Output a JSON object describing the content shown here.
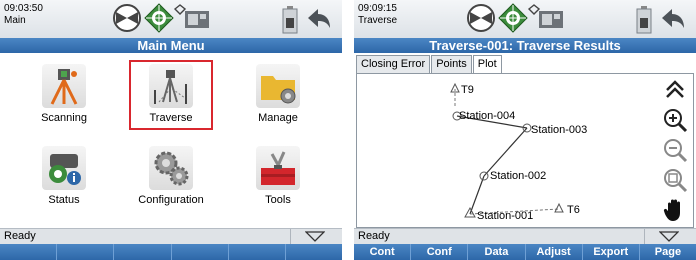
{
  "left_panel": {
    "clock": {
      "time": "09:03:50",
      "mode": "Main"
    },
    "title": "Main Menu",
    "items": [
      {
        "label": "Scanning",
        "icon": "scanning-icon"
      },
      {
        "label": "Traverse",
        "icon": "traverse-icon",
        "selected": true
      },
      {
        "label": "Manage",
        "icon": "manage-icon"
      },
      {
        "label": "Status",
        "icon": "status-icon"
      },
      {
        "label": "Configuration",
        "icon": "configuration-icon"
      },
      {
        "label": "Tools",
        "icon": "tools-icon"
      }
    ],
    "status": "Ready",
    "softkeys": [
      "",
      "",
      "",
      "",
      "",
      ""
    ]
  },
  "right_panel": {
    "clock": {
      "time": "09:09:15",
      "mode": "Traverse"
    },
    "title": "Traverse-001: Traverse Results",
    "tabs": [
      {
        "label": "Closing Error",
        "active": false
      },
      {
        "label": "Points",
        "active": false
      },
      {
        "label": "Plot",
        "active": true
      }
    ],
    "plot": {
      "stations": [
        "T9",
        "Station-004",
        "Station-003",
        "Station-002",
        "Station-001",
        "T6"
      ]
    },
    "tools": [
      "collapse-icon",
      "zoom-in-icon",
      "zoom-out-icon",
      "zoom-fit-icon",
      "pan-hand-icon"
    ],
    "status": "Ready",
    "softkeys": [
      "Cont",
      "Conf",
      "Data",
      "Adjust",
      "Export",
      "Page"
    ]
  },
  "colors": {
    "accent": "#2d67a8",
    "selection": "#d9272e"
  }
}
